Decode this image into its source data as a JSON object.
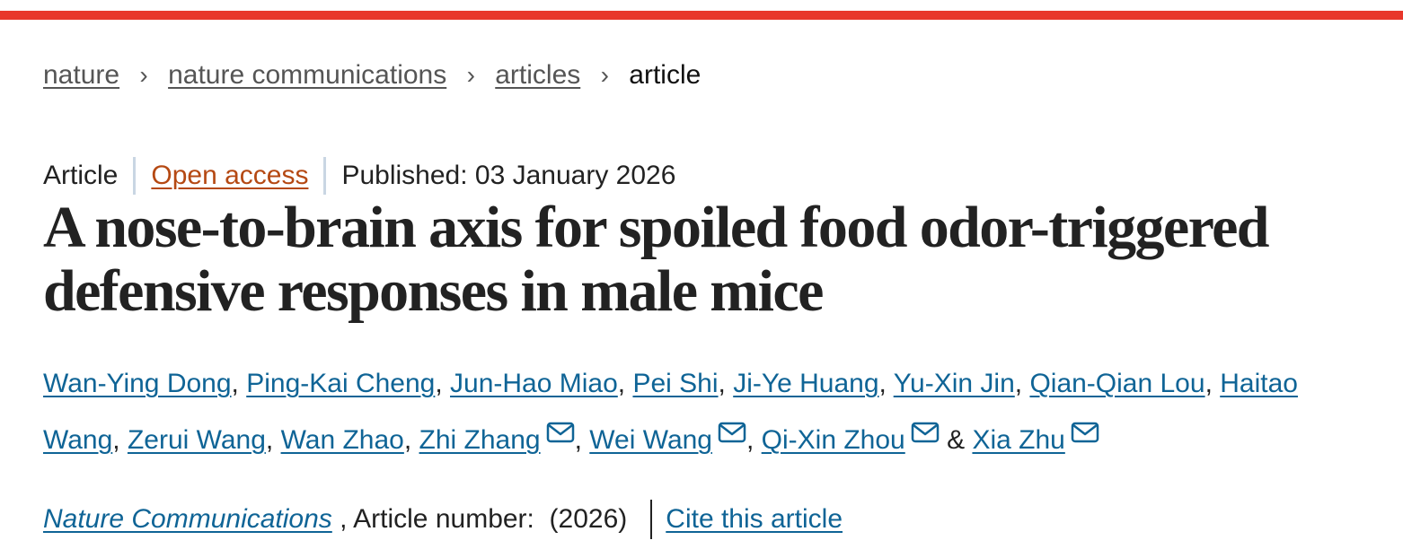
{
  "breadcrumb": {
    "items": [
      "nature",
      "nature communications",
      "articles"
    ],
    "current": "article",
    "separator": "›"
  },
  "meta": {
    "type": "Article",
    "access": "Open access",
    "published": "Published: 03 January 2026"
  },
  "title": "A nose-to-brain axis for spoiled food odor-triggered defensive responses in male mice",
  "authors": [
    {
      "name": "Wan-Ying Dong",
      "corresponding": false
    },
    {
      "name": "Ping-Kai Cheng",
      "corresponding": false
    },
    {
      "name": "Jun-Hao Miao",
      "corresponding": false
    },
    {
      "name": "Pei Shi",
      "corresponding": false
    },
    {
      "name": "Ji-Ye Huang",
      "corresponding": false
    },
    {
      "name": "Yu-Xin Jin",
      "corresponding": false
    },
    {
      "name": "Qian-Qian Lou",
      "corresponding": false
    },
    {
      "name": "Haitao Wang",
      "corresponding": false
    },
    {
      "name": "Zerui Wang",
      "corresponding": false
    },
    {
      "name": "Wan Zhao",
      "corresponding": false
    },
    {
      "name": "Zhi Zhang",
      "corresponding": true
    },
    {
      "name": "Wei Wang",
      "corresponding": true
    },
    {
      "name": "Qi-Xin Zhou",
      "corresponding": true
    },
    {
      "name": "Xia Zhu",
      "corresponding": true
    }
  ],
  "author_separator": ", ",
  "author_last_separator": " & ",
  "icons": {
    "corresponding_author": "envelope-icon"
  },
  "journal": {
    "name": "Nature Communications",
    "article_number": " , Article number:  (2026)",
    "cite_label": "Cite this article"
  },
  "colors": {
    "top_bar": "#e8372b",
    "link": "#0f6496",
    "open_access": "#b54913"
  }
}
